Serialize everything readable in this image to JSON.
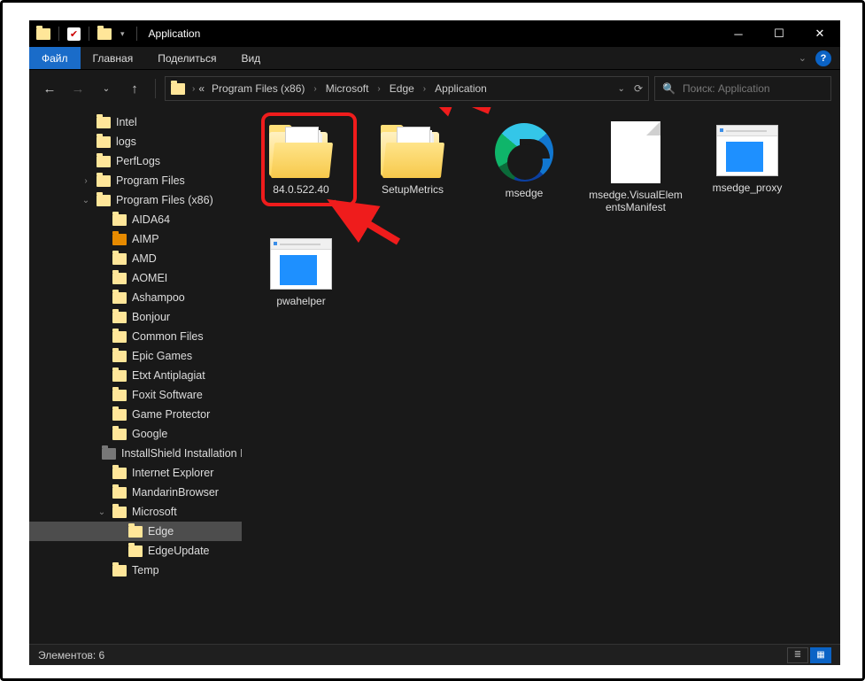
{
  "window": {
    "title": "Application"
  },
  "ribbon": {
    "file": "Файл",
    "tabs": [
      "Главная",
      "Поделиться",
      "Вид"
    ]
  },
  "breadcrumb": {
    "overflow": "«",
    "items": [
      "Program Files (x86)",
      "Microsoft",
      "Edge",
      "Application"
    ]
  },
  "search": {
    "placeholder": "Поиск: Application"
  },
  "tree": [
    {
      "d": 1,
      "t": "",
      "l": "Intel",
      "c": "y"
    },
    {
      "d": 1,
      "t": "",
      "l": "logs",
      "c": "y"
    },
    {
      "d": 1,
      "t": "",
      "l": "PerfLogs",
      "c": "y"
    },
    {
      "d": 1,
      "t": "›",
      "l": "Program Files",
      "c": "y"
    },
    {
      "d": 1,
      "t": "⌄",
      "l": "Program Files (x86)",
      "c": "y"
    },
    {
      "d": 2,
      "t": "",
      "l": "AIDA64",
      "c": "y"
    },
    {
      "d": 2,
      "t": "",
      "l": "AIMP",
      "c": "o"
    },
    {
      "d": 2,
      "t": "",
      "l": "AMD",
      "c": "y"
    },
    {
      "d": 2,
      "t": "",
      "l": "AOMEI",
      "c": "y"
    },
    {
      "d": 2,
      "t": "",
      "l": "Ashampoo",
      "c": "y"
    },
    {
      "d": 2,
      "t": "",
      "l": "Bonjour",
      "c": "y"
    },
    {
      "d": 2,
      "t": "",
      "l": "Common Files",
      "c": "y"
    },
    {
      "d": 2,
      "t": "",
      "l": "Epic Games",
      "c": "y"
    },
    {
      "d": 2,
      "t": "",
      "l": "Etxt Antiplagiat",
      "c": "y"
    },
    {
      "d": 2,
      "t": "",
      "l": "Foxit Software",
      "c": "y"
    },
    {
      "d": 2,
      "t": "",
      "l": "Game Protector",
      "c": "y"
    },
    {
      "d": 2,
      "t": "",
      "l": "Google",
      "c": "y"
    },
    {
      "d": 2,
      "t": "",
      "l": "InstallShield Installation Informat",
      "c": "g"
    },
    {
      "d": 2,
      "t": "",
      "l": "Internet Explorer",
      "c": "y"
    },
    {
      "d": 2,
      "t": "",
      "l": "MandarinBrowser",
      "c": "y"
    },
    {
      "d": 2,
      "t": "⌄",
      "l": "Microsoft",
      "c": "y"
    },
    {
      "d": 3,
      "t": "",
      "l": "Edge",
      "c": "y",
      "sel": true
    },
    {
      "d": 3,
      "t": "",
      "l": "EdgeUpdate",
      "c": "y"
    },
    {
      "d": 2,
      "t": "",
      "l": "Temp",
      "c": "y"
    }
  ],
  "items": [
    {
      "type": "folder",
      "label": "84.0.522.40"
    },
    {
      "type": "folder",
      "label": "SetupMetrics"
    },
    {
      "type": "edge",
      "label": "msedge"
    },
    {
      "type": "doc",
      "label": "msedge.VisualElementsManifest"
    },
    {
      "type": "app",
      "label": "msedge_proxy"
    },
    {
      "type": "app",
      "label": "pwahelper"
    }
  ],
  "status": {
    "text": "Элементов: 6"
  }
}
